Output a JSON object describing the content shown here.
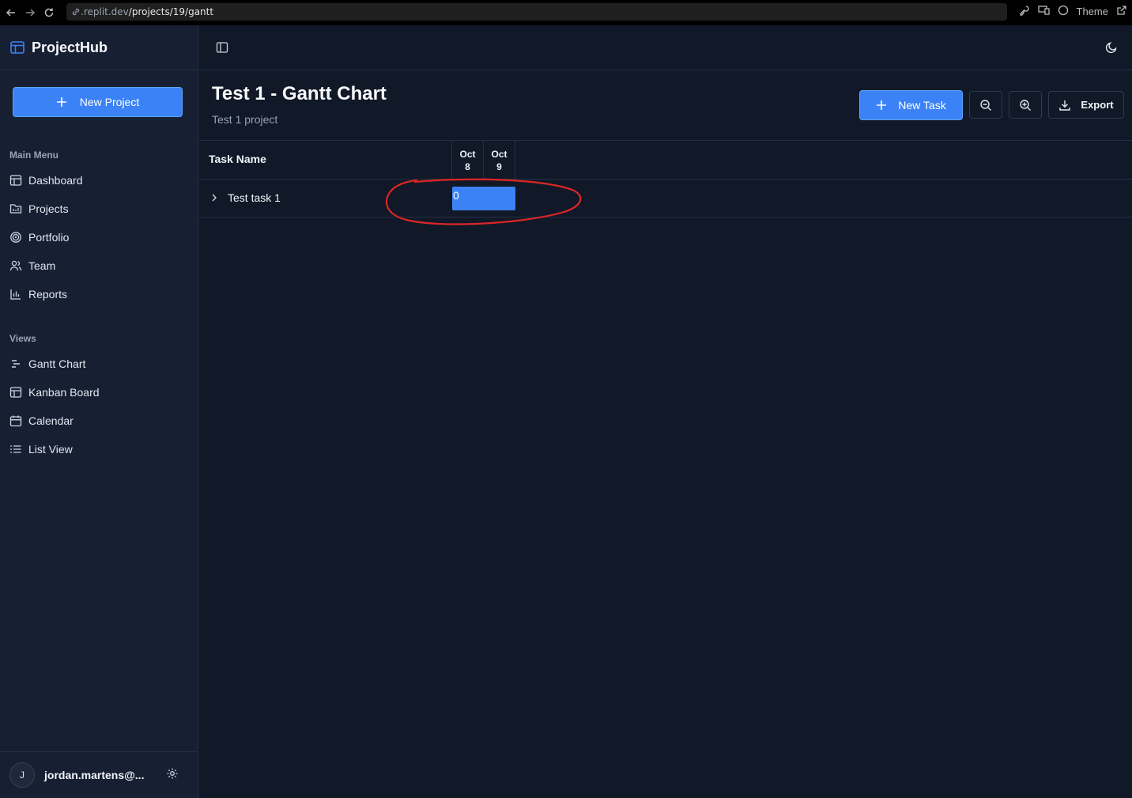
{
  "browser": {
    "url_prefix": ".replit.dev",
    "url_path": "/projects/19/gantt",
    "theme_label": "Theme"
  },
  "sidebar": {
    "brand": "ProjectHub",
    "new_project_label": "New Project",
    "main_menu_label": "Main Menu",
    "main_menu": [
      {
        "label": "Dashboard",
        "icon": "layout-icon"
      },
      {
        "label": "Projects",
        "icon": "folder-icon"
      },
      {
        "label": "Portfolio",
        "icon": "target-icon"
      },
      {
        "label": "Team",
        "icon": "users-icon"
      },
      {
        "label": "Reports",
        "icon": "bar-chart-icon"
      }
    ],
    "views_label": "Views",
    "views": [
      {
        "label": "Gantt Chart",
        "icon": "gantt-icon"
      },
      {
        "label": "Kanban Board",
        "icon": "kanban-icon"
      },
      {
        "label": "Calendar",
        "icon": "calendar-icon"
      },
      {
        "label": "List View",
        "icon": "list-icon"
      }
    ],
    "user": {
      "initial": "J",
      "email": "jordan.martens@..."
    }
  },
  "header": {
    "title": "Test 1 - Gantt Chart",
    "subtitle": "Test 1 project",
    "new_task_label": "New Task",
    "export_label": "Export"
  },
  "gantt": {
    "task_column_label": "Task Name",
    "dates": [
      {
        "month": "Oct",
        "day": "8"
      },
      {
        "month": "Oct",
        "day": "9"
      }
    ],
    "tasks": [
      {
        "name": "Test task 1",
        "bar_label": "0"
      }
    ]
  },
  "colors": {
    "accent": "#3b82f6",
    "background": "#111827",
    "sidebar": "#172033",
    "annotation": "#dc2626"
  }
}
